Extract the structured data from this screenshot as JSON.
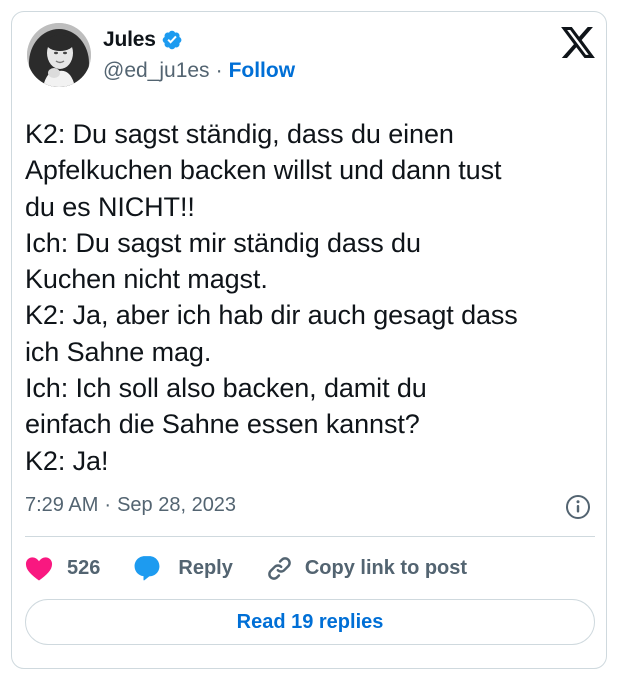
{
  "author": {
    "name": "Jules",
    "handle": "@ed_ju1es",
    "separator": "·",
    "follow_label": "Follow",
    "avatar_icon": "profile-photo",
    "verified_icon": "verified-badge-icon",
    "verified_color": "#1d9bf0"
  },
  "platform": {
    "logo_icon": "x-logo-icon"
  },
  "tweet": {
    "lines": [
      "K2: Du sagst ständig, dass du einen",
      "Apfelkuchen backen willst und dann tust",
      "du es NICHT!!",
      "Ich: Du sagst mir ständig dass du",
      "Kuchen nicht magst.",
      "K2: Ja, aber ich hab dir auch gesagt dass",
      "ich Sahne mag.",
      "Ich: Ich soll also backen, damit du",
      "einfach die Sahne essen kannst?",
      "K2: Ja!"
    ],
    "time": "7:29 AM",
    "separator": "·",
    "date": "Sep 28, 2023",
    "info_icon": "info-icon"
  },
  "actions": {
    "like_count": "526",
    "like_icon": "heart-icon",
    "like_color": "#f91880",
    "reply_label": "Reply",
    "reply_icon": "speech-bubble-icon",
    "reply_color": "#1d9bf0",
    "copy_label": "Copy link to post",
    "copy_icon": "link-icon"
  },
  "footer": {
    "read_replies_label": "Read 19 replies"
  },
  "colors": {
    "text": "#0f1419",
    "muted": "#536471",
    "link": "#006fd6",
    "border": "#cfd9de"
  }
}
